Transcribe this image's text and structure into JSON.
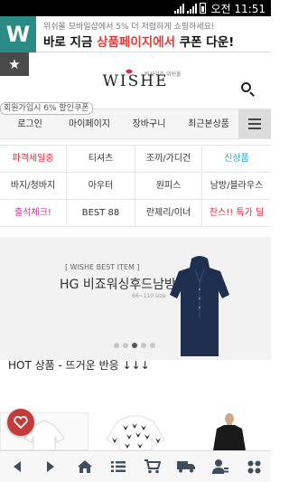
{
  "status_bar": {
    "time": "오전 11:51"
  },
  "notification": {
    "logo_letter": "W",
    "line1": "위쉬몰 모바일샵에서 5% 더 저렴하게 쇼핑하세요!",
    "line2_pre": "바로 지금 ",
    "line2_highlight": "상품페이지에서",
    "line2_post": " 쿠폰 다운!"
  },
  "header": {
    "bookmark_symbol": "★",
    "logo_sub": "빅사이즈 위쉬몰",
    "logo": "WISHE",
    "coupon_tag": "회원가입시 6% 할인쿠폰"
  },
  "nav": {
    "items": [
      "로그인",
      "마이페이지",
      "장바구니",
      "최근본상품"
    ]
  },
  "categories": [
    {
      "label": "파격세일중",
      "color": "#e0283a"
    },
    {
      "label": "티셔츠",
      "color": "#333333"
    },
    {
      "label": "조끼/가디건",
      "color": "#333333"
    },
    {
      "label": "신상품",
      "color": "#2aa5c8"
    },
    {
      "label": "바지/청바지",
      "color": "#333333"
    },
    {
      "label": "아우터",
      "color": "#333333"
    },
    {
      "label": "원피스",
      "color": "#333333"
    },
    {
      "label": "남방/블라우스",
      "color": "#333333"
    },
    {
      "label": "출석체크!",
      "color": "#c837a8"
    },
    {
      "label": "BEST 88",
      "color": "#333333"
    },
    {
      "label": "란제리/이너",
      "color": "#333333"
    },
    {
      "label": "찬스!! 특가 딜",
      "color": "#e0283a"
    }
  ],
  "hero": {
    "tag": "[ WISHE BEST ITEM ]",
    "title": "HG 비죠워싱후드남방",
    "size": "66~110 size",
    "dots_total": 5,
    "active_index": 2
  },
  "section": {
    "title": "HOT 상품 - 뜨거운 반응 ↓↓↓"
  },
  "colors": {
    "brand": "#2b8c86",
    "highlight_red": "#e23b3b",
    "fab_red": "#c43b3b",
    "shirt_navy": "#1f2f4f"
  },
  "icons": {
    "toolbar": [
      "back-icon",
      "forward-icon",
      "home-icon",
      "list-icon",
      "cart-icon",
      "delivery-icon",
      "my-account-icon",
      "grid-menu-icon"
    ],
    "fab": "heart-icon"
  }
}
